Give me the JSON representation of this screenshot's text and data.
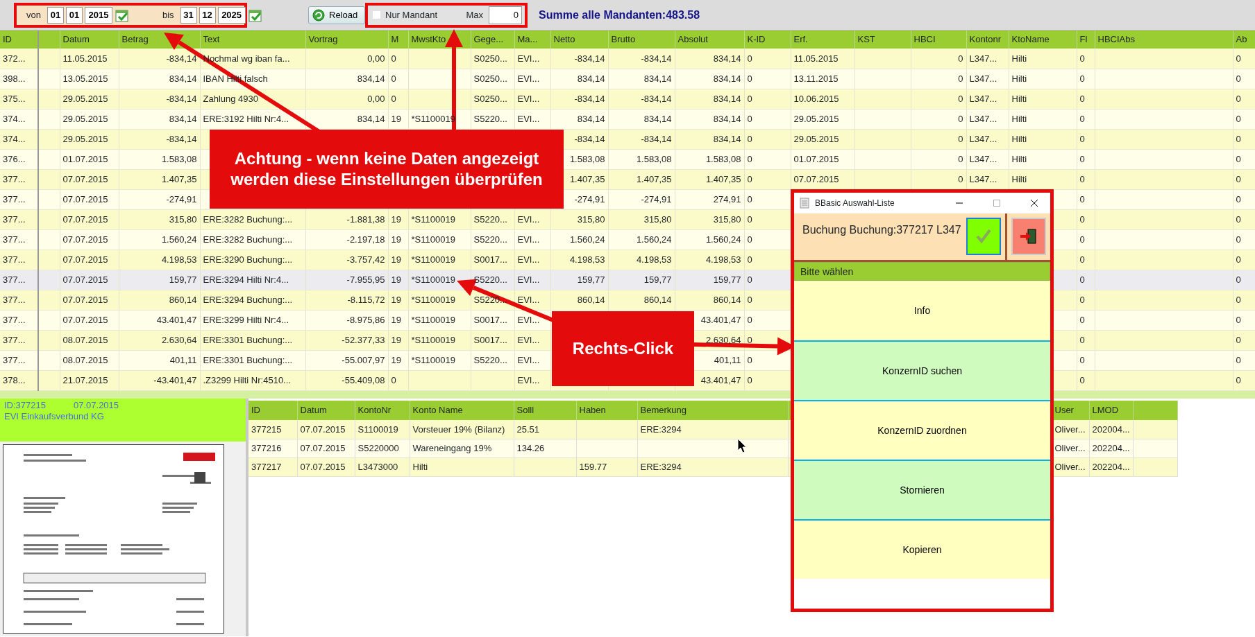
{
  "toolbar": {
    "date_from": {
      "label": "von",
      "day": "01",
      "month": "01",
      "year": "2015"
    },
    "date_to": {
      "label": "bis",
      "day": "31",
      "month": "12",
      "year": "2025"
    },
    "reload_button": "Reload",
    "nur_mandant": {
      "label": "Nur Mandant",
      "checked": false
    },
    "max": {
      "label": "Max",
      "value": "0"
    },
    "summary": "Summe alle Mandanten:483.58"
  },
  "main_table": {
    "columns": [
      {
        "label": "ID"
      },
      {},
      {
        "label": "Datum"
      },
      {
        "label": "Betrag"
      },
      {
        "label": "Text"
      },
      {
        "label": "Vortrag"
      },
      {
        "label": "M"
      },
      {
        "label": "MwstKto"
      },
      {
        "label": "Gege..."
      },
      {
        "label": "Ma..."
      },
      {
        "label": "Netto"
      },
      {
        "label": "Brutto"
      },
      {
        "label": "Absolut"
      },
      {
        "label": "K-ID"
      },
      {
        "label": "Erf."
      },
      {
        "label": "KST"
      },
      {
        "label": "HBCI"
      },
      {
        "label": "Kontonr"
      },
      {
        "label": "KtoName"
      },
      {
        "label": "Fl"
      },
      {
        "label": "HBCIAbs"
      },
      {
        "label": "Ab"
      }
    ],
    "rows": [
      {
        "selected": false,
        "cells": [
          "372...",
          null,
          "11.05.2015",
          "-834,14",
          "Nochmal wg iban fa...",
          "0,00",
          "0",
          null,
          "S0250...",
          "EVI...",
          "-834,14",
          "-834,14",
          "834,14",
          "0",
          "11.05.2015",
          null,
          "0",
          "L347...",
          "Hilti",
          "0",
          null,
          "0"
        ]
      },
      {
        "selected": false,
        "cells": [
          "398...",
          null,
          "13.05.2015",
          "834,14",
          "IBAN Hilti falsch",
          "834,14",
          "0",
          null,
          "S0250...",
          "EVI...",
          "834,14",
          "834,14",
          "834,14",
          "0",
          "13.11.2015",
          null,
          "0",
          "L347...",
          "Hilti",
          "0",
          null,
          "0"
        ]
      },
      {
        "selected": false,
        "cells": [
          "375...",
          null,
          "29.05.2015",
          "-834,14",
          "Zahlung 4930",
          "0,00",
          "0",
          null,
          "S0250...",
          "EVI...",
          "-834,14",
          "-834,14",
          "834,14",
          "0",
          "10.06.2015",
          null,
          "0",
          "L347...",
          "Hilti",
          "0",
          null,
          "0"
        ]
      },
      {
        "selected": false,
        "cells": [
          "374...",
          null,
          "29.05.2015",
          "834,14",
          "ERE:3192 Hilti Nr:4...",
          "834,14",
          "19",
          "*S1100019",
          "S5220...",
          "EVI...",
          "834,14",
          "834,14",
          "834,14",
          "0",
          "29.05.2015",
          null,
          "0",
          "L347...",
          "Hilti",
          "0",
          null,
          "0"
        ]
      },
      {
        "selected": false,
        "cells": [
          "374...",
          null,
          "29.05.2015",
          "-834,14",
          null,
          null,
          null,
          null,
          null,
          null,
          "-834,14",
          "-834,14",
          "834,14",
          "0",
          "29.05.2015",
          null,
          "0",
          "L347...",
          "Hilti",
          "0",
          null,
          "0"
        ]
      },
      {
        "selected": false,
        "cells": [
          "376...",
          null,
          "01.07.2015",
          "1.583,08",
          null,
          null,
          null,
          null,
          null,
          null,
          "1.583,08",
          "1.583,08",
          "1.583,08",
          "0",
          "01.07.2015",
          null,
          "0",
          "L347...",
          "Hilti",
          "0",
          null,
          "0"
        ]
      },
      {
        "selected": false,
        "cells": [
          "377...",
          null,
          "07.07.2015",
          "1.407,35",
          null,
          null,
          null,
          null,
          null,
          null,
          "1.407,35",
          "1.407,35",
          "1.407,35",
          "0",
          "07.07.2015",
          null,
          "0",
          "L347...",
          "Hilti",
          "0",
          null,
          "0"
        ]
      },
      {
        "selected": false,
        "cells": [
          "377...",
          null,
          "07.07.2015",
          "-274,91",
          null,
          null,
          null,
          null,
          null,
          null,
          "-274,91",
          "-274,91",
          "274,91",
          "0",
          null,
          null,
          null,
          null,
          null,
          "0",
          null,
          "0"
        ]
      },
      {
        "selected": false,
        "cells": [
          "377...",
          null,
          "07.07.2015",
          "315,80",
          "ERE:3282 Buchung:...",
          "-1.881,38",
          "19",
          "*S1100019",
          "S5220...",
          "EVI...",
          "315,80",
          "315,80",
          "315,80",
          "0",
          null,
          null,
          null,
          null,
          null,
          "0",
          null,
          "0"
        ]
      },
      {
        "selected": false,
        "cells": [
          "377...",
          null,
          "07.07.2015",
          "1.560,24",
          "ERE:3282 Buchung:...",
          "-2.197,18",
          "19",
          "*S1100019",
          "S5220...",
          "EVI...",
          "1.560,24",
          "1.560,24",
          "1.560,24",
          "0",
          null,
          null,
          null,
          null,
          null,
          "0",
          null,
          "0"
        ]
      },
      {
        "selected": false,
        "cells": [
          "377...",
          null,
          "07.07.2015",
          "4.198,53",
          "ERE:3290 Buchung:...",
          "-3.757,42",
          "19",
          "*S1100019",
          "S0017...",
          "EVI...",
          "4.198,53",
          "4.198,53",
          "4.198,53",
          "0",
          null,
          null,
          null,
          null,
          null,
          "0",
          null,
          "0"
        ]
      },
      {
        "selected": true,
        "cells": [
          "377...",
          null,
          "07.07.2015",
          "159,77",
          "ERE:3294 Hilti Nr:4...",
          "-7.955,95",
          "19",
          "*S1100019",
          "S5220...",
          "EVI...",
          "159,77",
          "159,77",
          "159,77",
          "0",
          null,
          null,
          null,
          null,
          null,
          "0",
          null,
          "0"
        ]
      },
      {
        "selected": false,
        "cells": [
          "377...",
          null,
          "07.07.2015",
          "860,14",
          "ERE:3294 Buchung:...",
          "-8.115,72",
          "19",
          "*S1100019",
          "S5220...",
          "EVI...",
          "860,14",
          "860,14",
          "860,14",
          "0",
          null,
          null,
          null,
          null,
          null,
          "0",
          null,
          "0"
        ]
      },
      {
        "selected": false,
        "cells": [
          "377...",
          null,
          "07.07.2015",
          "43.401,47",
          "ERE:3299 Hilti Nr:4...",
          "-8.975,86",
          "19",
          "*S1100019",
          "S0017...",
          "EVI...",
          null,
          null,
          "43.401,47",
          "0",
          null,
          null,
          null,
          null,
          null,
          "0",
          null,
          "0"
        ]
      },
      {
        "selected": false,
        "cells": [
          "377...",
          null,
          "08.07.2015",
          "2.630,64",
          "ERE:3301 Buchung:...",
          "-52.377,33",
          "19",
          "*S1100019",
          "S0017...",
          "EVI...",
          null,
          null,
          "2.630,64",
          "0",
          null,
          null,
          null,
          null,
          null,
          "0",
          null,
          "0"
        ]
      },
      {
        "selected": false,
        "cells": [
          "377...",
          null,
          "08.07.2015",
          "401,11",
          "ERE:3301 Buchung:...",
          "-55.007,97",
          "19",
          "*S1100019",
          "S5220...",
          "EVI...",
          null,
          null,
          "401,11",
          "0",
          null,
          null,
          null,
          null,
          null,
          "0",
          null,
          "0"
        ]
      },
      {
        "selected": false,
        "cells": [
          "378...",
          null,
          "21.07.2015",
          "-43.401,47",
          ".Z3299 Hilti Nr:4510...",
          "-55.409,08",
          "0",
          null,
          null,
          "EVI...",
          null,
          null,
          "43.401,47",
          "0",
          null,
          null,
          null,
          null,
          null,
          "0",
          null,
          "0"
        ]
      }
    ]
  },
  "detail_panel": {
    "id": "ID:377215",
    "date": "07.07.2015",
    "company": "EVI Einkaufsverbund KG"
  },
  "booking_table": {
    "columns": [
      {
        "label": "ID"
      },
      {
        "label": "Datum"
      },
      {
        "label": "KontoNr"
      },
      {
        "label": "Konto Name"
      },
      {
        "label": "Solll"
      },
      {
        "label": "Haben"
      },
      {
        "label": "Bemerkung"
      },
      {},
      {
        "label": "User"
      },
      {
        "label": "LMOD"
      },
      {}
    ],
    "rows": [
      {
        "cells": [
          "377215",
          "07.07.2015",
          "S1100019",
          "Vorsteuer 19% (Bilanz)",
          "25.51",
          null,
          "ERE:3294",
          null,
          "Oliver...",
          "202004...",
          null
        ]
      },
      {
        "cells": [
          "377216",
          "07.07.2015",
          "S5220000",
          "Wareneingang 19%",
          "134.26",
          null,
          null,
          null,
          "Oliver...",
          "202204...",
          null
        ]
      },
      {
        "cells": [
          "377217",
          "07.07.2015",
          "L3473000",
          "Hilti",
          null,
          "159.77",
          "ERE:3294",
          null,
          "Oliver...",
          "202204...",
          null
        ]
      }
    ]
  },
  "popup": {
    "title": "BBasic Auswahl-Liste",
    "message": "Buchung Buchung:377217 L347",
    "heading": "Bitte wählen",
    "options": [
      "Info",
      "KonzernID suchen",
      "KonzernID zuordnen",
      "Stornieren",
      "Kopieren"
    ]
  },
  "annotations": [
    {
      "text": "Achtung - wenn keine Daten angezeigt werden diese Einstellungen überprüfen"
    },
    {
      "text": "Rechts-Click"
    }
  ]
}
